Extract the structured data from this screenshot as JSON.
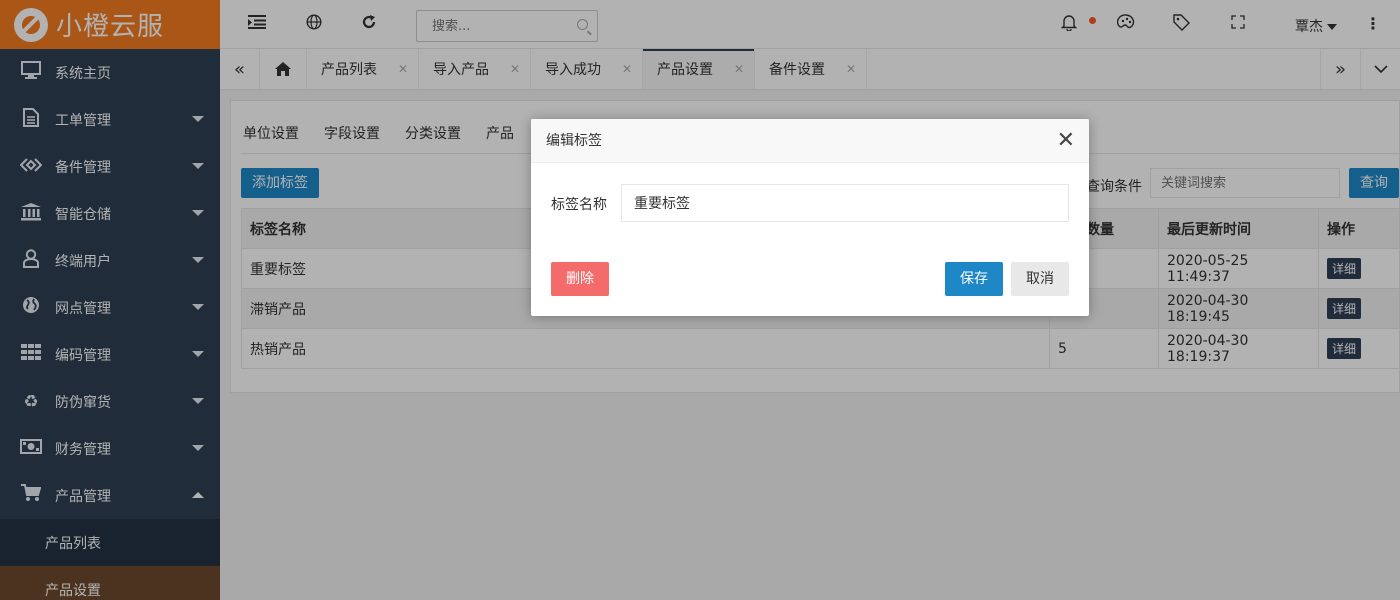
{
  "app": {
    "name": "小橙云服",
    "brand_color": "#f47b20"
  },
  "sidebar": {
    "items": [
      {
        "label": "系统主页",
        "icon": "monitor-icon"
      },
      {
        "label": "工单管理",
        "icon": "document-icon"
      },
      {
        "label": "备件管理",
        "icon": "diamond-icon"
      },
      {
        "label": "智能仓储",
        "icon": "bank-icon"
      },
      {
        "label": "终端用户",
        "icon": "user-icon"
      },
      {
        "label": "网点管理",
        "icon": "globe-icon"
      },
      {
        "label": "编码管理",
        "icon": "grid-icon"
      },
      {
        "label": "防伪窜货",
        "icon": "recycle-icon"
      },
      {
        "label": "财务管理",
        "icon": "money-icon"
      },
      {
        "label": "产品管理",
        "icon": "cart-icon"
      }
    ],
    "subitems": [
      {
        "label": "产品列表"
      },
      {
        "label": "产品设置",
        "active": true
      }
    ]
  },
  "topbar": {
    "search_placeholder": "搜索...",
    "user_name": "覃杰"
  },
  "tabs": [
    {
      "label": "产品列表"
    },
    {
      "label": "导入产品"
    },
    {
      "label": "导入成功"
    },
    {
      "label": "产品设置",
      "active": true
    },
    {
      "label": "备件设置"
    }
  ],
  "content": {
    "subtabs": [
      "单位设置",
      "字段设置",
      "分类设置",
      "产品"
    ],
    "add_button": "添加标签",
    "query_label": "查询条件",
    "query_placeholder": "关键词搜索",
    "query_button": "查询",
    "table": {
      "headers": [
        "标签名称",
        "数量",
        "最后更新时间",
        "操作"
      ],
      "rows": [
        {
          "name": "重要标签",
          "count": "",
          "updated": "2020-05-25 11:49:37",
          "action": "详细"
        },
        {
          "name": "滞销产品",
          "count": "",
          "updated": "2020-04-30 18:19:45",
          "action": "详细"
        },
        {
          "name": "热销产品",
          "count": "5",
          "updated": "2020-04-30 18:19:37",
          "action": "详细"
        }
      ]
    }
  },
  "modal": {
    "title": "编辑标签",
    "field_label": "标签名称",
    "field_value": "重要标签",
    "delete_button": "删除",
    "save_button": "保存",
    "cancel_button": "取消"
  }
}
